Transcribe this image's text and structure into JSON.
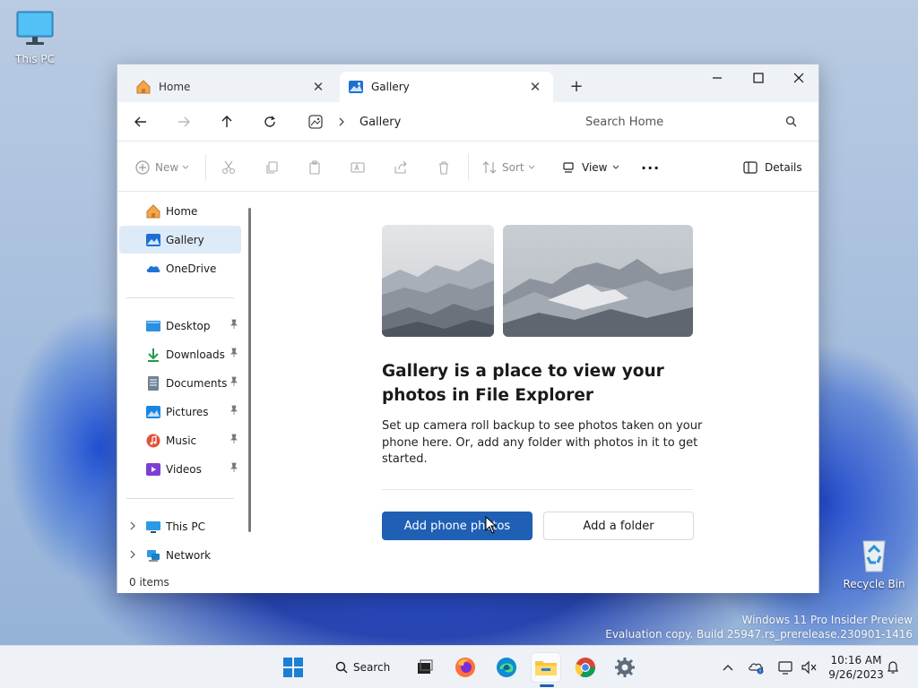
{
  "desktop": {
    "icons": [
      {
        "label": "This PC"
      },
      {
        "label": "Recycle Bin"
      }
    ],
    "watermark": {
      "line1": "Windows 11 Pro Insider Preview",
      "line2": "Evaluation copy. Build 25947.rs_prerelease.230901-1416"
    }
  },
  "window": {
    "tabs": [
      {
        "label": "Home",
        "icon": "home-icon",
        "active": false
      },
      {
        "label": "Gallery",
        "icon": "gallery-icon",
        "active": true
      }
    ],
    "controls": {
      "minimize": "minimize-icon",
      "maximize": "maximize-icon",
      "close": "close-icon"
    },
    "address": {
      "breadcrumb": "Gallery",
      "search_placeholder": "Search Home"
    },
    "toolbar": {
      "new_label": "New",
      "sort_label": "Sort",
      "view_label": "View",
      "more_label": "···",
      "details_label": "Details"
    },
    "sidebar": {
      "quick": [
        {
          "label": "Home",
          "icon": "home-icon"
        },
        {
          "label": "Gallery",
          "icon": "gallery-icon",
          "selected": true
        },
        {
          "label": "OneDrive",
          "icon": "onedrive-icon"
        }
      ],
      "pinned": [
        {
          "label": "Desktop",
          "icon": "desktop-folder-icon"
        },
        {
          "label": "Downloads",
          "icon": "downloads-icon"
        },
        {
          "label": "Documents",
          "icon": "documents-icon"
        },
        {
          "label": "Pictures",
          "icon": "pictures-icon"
        },
        {
          "label": "Music",
          "icon": "music-icon"
        },
        {
          "label": "Videos",
          "icon": "videos-icon"
        }
      ],
      "locations": [
        {
          "label": "This PC",
          "icon": "computer-icon"
        },
        {
          "label": "Network",
          "icon": "network-icon"
        }
      ]
    },
    "content": {
      "title": "Gallery is a place to view your photos in File Explorer",
      "description": "Set up camera roll backup to see photos taken on your phone here. Or, add any folder with photos in it to get started.",
      "primary_button": "Add phone photos",
      "secondary_button": "Add a folder"
    },
    "status": "0 items"
  },
  "taskbar": {
    "search_label": "Search",
    "time": "10:16 AM",
    "date": "9/26/2023"
  },
  "colors": {
    "accent": "#1f5fb4",
    "selection": "#ddeaf8"
  }
}
